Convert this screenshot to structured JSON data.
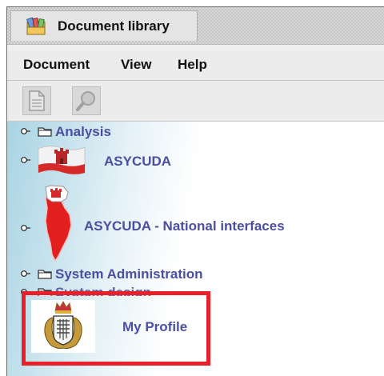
{
  "window": {
    "title": "Document library",
    "accent_highlight_color": "#e8202a"
  },
  "menubar": {
    "items": [
      "Document",
      "View",
      "Help"
    ]
  },
  "toolbar": {
    "buttons": [
      {
        "icon": "document-icon"
      },
      {
        "icon": "search-icon"
      }
    ]
  },
  "tree": {
    "items": [
      {
        "label": "Analysis",
        "icon": "folder-icon"
      },
      {
        "label": "ASYCUDA",
        "icon": "gibraltar-flag-icon"
      },
      {
        "label": "ASYCUDA - National interfaces",
        "icon": "gibraltar-map-icon"
      },
      {
        "label": "System Administration",
        "icon": "folder-icon"
      },
      {
        "label": "System design",
        "icon": "folder-icon"
      },
      {
        "label": "My Profile",
        "icon": "crest-icon"
      }
    ]
  }
}
